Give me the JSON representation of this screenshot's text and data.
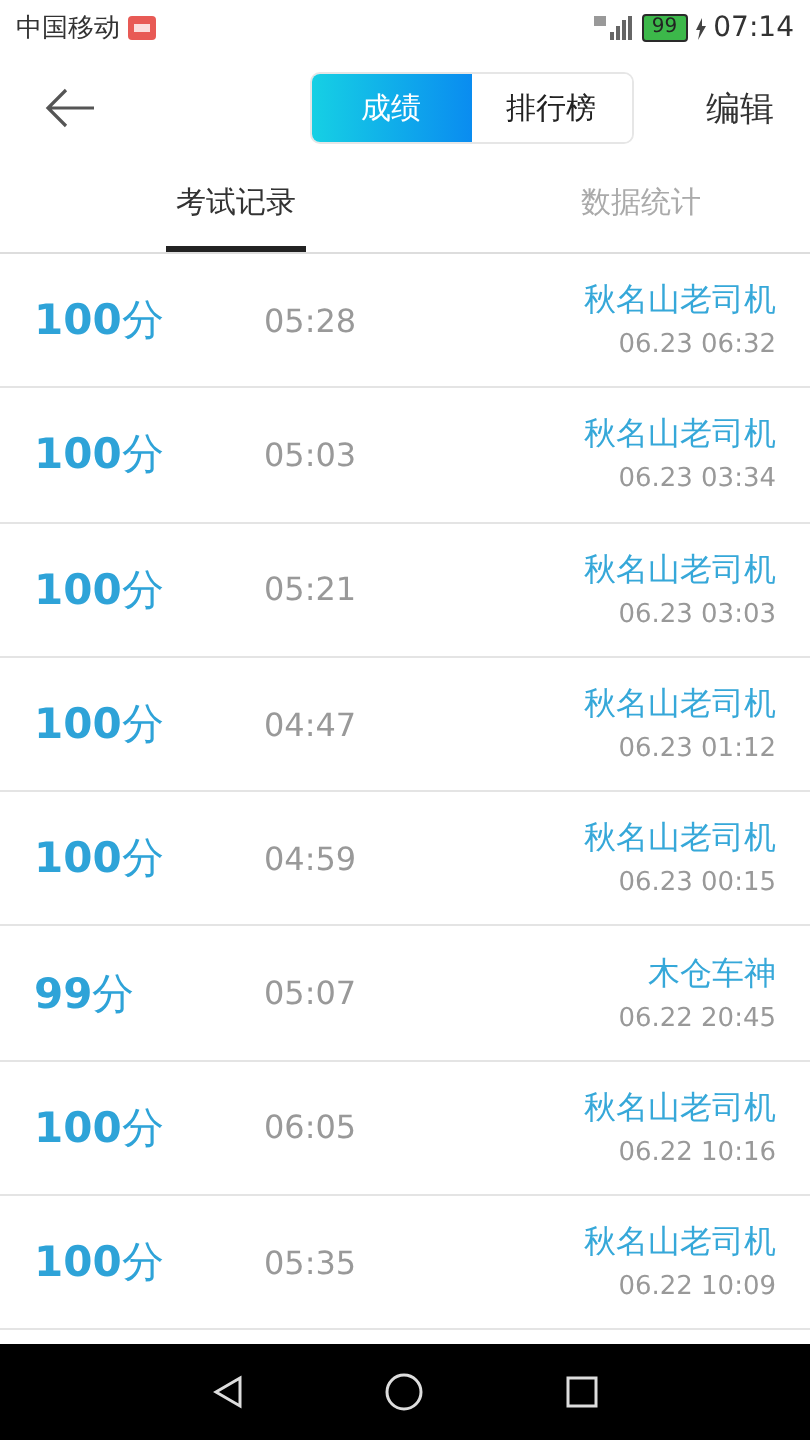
{
  "status_bar": {
    "carrier": "中国移动",
    "battery": "99",
    "time": "07:14"
  },
  "toolbar": {
    "segments": [
      {
        "label": "成绩",
        "selected": true
      },
      {
        "label": "排行榜",
        "selected": false
      }
    ],
    "edit": "编辑"
  },
  "tabs": [
    {
      "label": "考试记录",
      "selected": true
    },
    {
      "label": "数据统计",
      "selected": false
    }
  ],
  "records": [
    {
      "score": "**100**分",
      "duration": "05:28",
      "name": "秋名山老司机",
      "date": "06.23  06:32"
    },
    {
      "score": "**100**分",
      "duration": "05:03",
      "name": "秋名山老司机",
      "date": "06.23  03:34"
    },
    {
      "score": "**100**分",
      "duration": "05:21",
      "name": "秋名山老司机",
      "date": "06.23  03:03"
    },
    {
      "score": "**100**分",
      "duration": "04:47",
      "name": "秋名山老司机",
      "date": "06.23  01:12"
    },
    {
      "score": "**100**分",
      "duration": "04:59",
      "name": "秋名山老司机",
      "date": "06.23  00:15"
    },
    {
      "score": "**99**分",
      "duration": "05:07",
      "name": "木仓车神",
      "date": "06.22  20:45"
    },
    {
      "score": "**100**分",
      "duration": "06:05",
      "name": "秋名山老司机",
      "date": "06.22  10:16"
    },
    {
      "score": "**100**分",
      "duration": "05:35",
      "name": "秋名山老司机",
      "date": "06.22  10:09"
    }
  ]
}
